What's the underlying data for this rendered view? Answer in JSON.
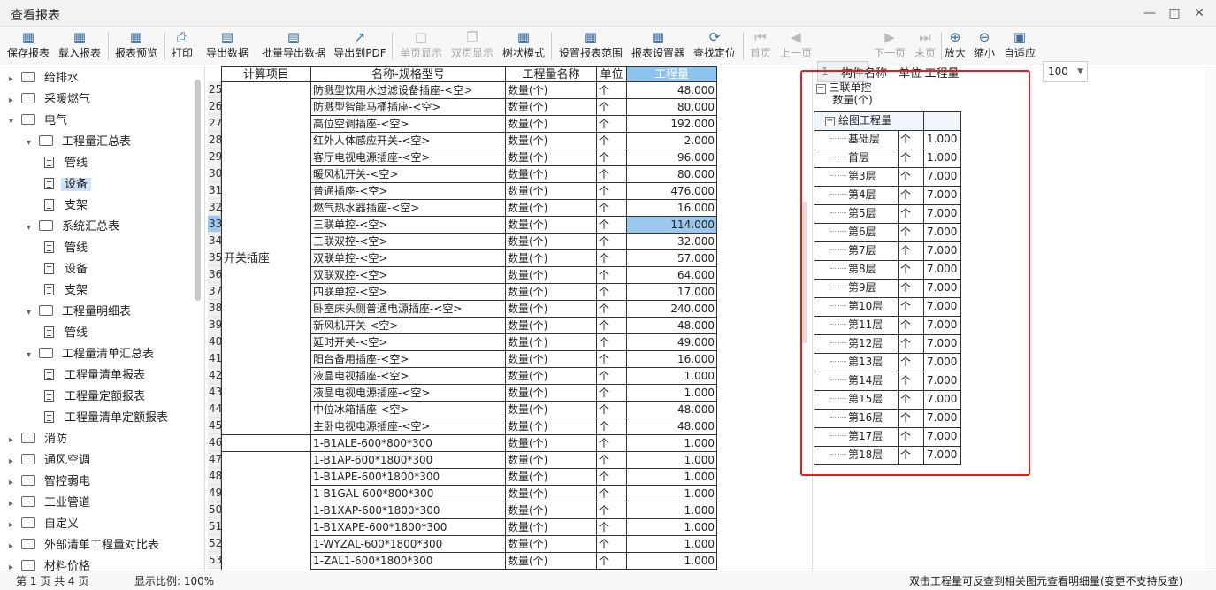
{
  "window": {
    "title": "查看报表"
  },
  "toolbar": {
    "save_report": "保存报表",
    "load_report": "载入报表",
    "preview_report": "报表预览",
    "print": "打印",
    "export_data": "导出数据",
    "batch_export": "批量导出数据",
    "export_pdf": "导出到PDF",
    "single_page": "单页显示",
    "two_page": "双页显示",
    "tree_mode": "树状模式",
    "set_range": "设置报表范围",
    "report_designer": "报表设置器",
    "find_locate": "查找定位",
    "first_page": "首页",
    "prev_page": "上一页",
    "page_value": "1",
    "next_page": "下一页",
    "last_page": "末页",
    "zoom_in": "放大",
    "zoom_out": "缩小",
    "fit": "自适应",
    "zoom_value": "100"
  },
  "tree": [
    {
      "label": "给排水",
      "level": 0,
      "type": "folder",
      "expanded": false
    },
    {
      "label": "采暖燃气",
      "level": 0,
      "type": "folder",
      "expanded": false
    },
    {
      "label": "电气",
      "level": 0,
      "type": "folder",
      "expanded": true
    },
    {
      "label": "工程量汇总表",
      "level": 1,
      "type": "folder",
      "expanded": true
    },
    {
      "label": "管线",
      "level": 2,
      "type": "doc"
    },
    {
      "label": "设备",
      "level": 2,
      "type": "doc",
      "selected": true
    },
    {
      "label": "支架",
      "level": 2,
      "type": "doc"
    },
    {
      "label": "系统汇总表",
      "level": 1,
      "type": "folder",
      "expanded": true
    },
    {
      "label": "管线",
      "level": 2,
      "type": "doc"
    },
    {
      "label": "设备",
      "level": 2,
      "type": "doc"
    },
    {
      "label": "支架",
      "level": 2,
      "type": "doc"
    },
    {
      "label": "工程量明细表",
      "level": 1,
      "type": "folder",
      "expanded": true
    },
    {
      "label": "管线",
      "level": 2,
      "type": "doc"
    },
    {
      "label": "工程量清单汇总表",
      "level": 1,
      "type": "folder",
      "expanded": true
    },
    {
      "label": "工程量清单报表",
      "level": 2,
      "type": "doc"
    },
    {
      "label": "工程量定额报表",
      "level": 2,
      "type": "doc"
    },
    {
      "label": "工程量清单定额报表",
      "level": 2,
      "type": "doc"
    },
    {
      "label": "消防",
      "level": 0,
      "type": "folder",
      "expanded": false
    },
    {
      "label": "通风空调",
      "level": 0,
      "type": "folder",
      "expanded": false
    },
    {
      "label": "智控弱电",
      "level": 0,
      "type": "folder",
      "expanded": false
    },
    {
      "label": "工业管道",
      "level": 0,
      "type": "folder",
      "expanded": false
    },
    {
      "label": "自定义",
      "level": 0,
      "type": "folder",
      "expanded": false
    },
    {
      "label": "外部清单工程量对比表",
      "level": 0,
      "type": "folder",
      "expanded": false
    },
    {
      "label": "材料价格",
      "level": 0,
      "type": "folder",
      "expanded": false
    }
  ],
  "report": {
    "headers": {
      "calc_item": "计算项目",
      "name_spec": "名称-规格型号",
      "qty_name": "工程量名称",
      "unit": "单位",
      "qty": "工程量"
    },
    "category": "开关插座",
    "rows": [
      {
        "no": "25",
        "name": "防溅型饮用水过滤设备插座-<空>",
        "qty_name": "数量(个)",
        "unit": "个",
        "qty": "48.000"
      },
      {
        "no": "26",
        "name": "防溅型智能马桶插座-<空>",
        "qty_name": "数量(个)",
        "unit": "个",
        "qty": "80.000"
      },
      {
        "no": "27",
        "name": "高位空调插座-<空>",
        "qty_name": "数量(个)",
        "unit": "个",
        "qty": "192.000"
      },
      {
        "no": "28",
        "name": "红外人体感应开关-<空>",
        "qty_name": "数量(个)",
        "unit": "个",
        "qty": "2.000"
      },
      {
        "no": "29",
        "name": "客厅电视电源插座-<空>",
        "qty_name": "数量(个)",
        "unit": "个",
        "qty": "96.000"
      },
      {
        "no": "30",
        "name": "暖风机开关-<空>",
        "qty_name": "数量(个)",
        "unit": "个",
        "qty": "80.000"
      },
      {
        "no": "31",
        "name": "普通插座-<空>",
        "qty_name": "数量(个)",
        "unit": "个",
        "qty": "476.000"
      },
      {
        "no": "32",
        "name": "燃气热水器插座-<空>",
        "qty_name": "数量(个)",
        "unit": "个",
        "qty": "16.000"
      },
      {
        "no": "33",
        "name": "三联单控-<空>",
        "qty_name": "数量(个)",
        "unit": "个",
        "qty": "114.000",
        "selected": true
      },
      {
        "no": "34",
        "name": "三联双控-<空>",
        "qty_name": "数量(个)",
        "unit": "个",
        "qty": "32.000"
      },
      {
        "no": "35",
        "name": "双联单控-<空>",
        "qty_name": "数量(个)",
        "unit": "个",
        "qty": "57.000"
      },
      {
        "no": "36",
        "name": "双联双控-<空>",
        "qty_name": "数量(个)",
        "unit": "个",
        "qty": "64.000"
      },
      {
        "no": "37",
        "name": "四联单控-<空>",
        "qty_name": "数量(个)",
        "unit": "个",
        "qty": "17.000"
      },
      {
        "no": "38",
        "name": "卧室床头侧普通电源插座-<空>",
        "qty_name": "数量(个)",
        "unit": "个",
        "qty": "240.000"
      },
      {
        "no": "39",
        "name": "新风机开关-<空>",
        "qty_name": "数量(个)",
        "unit": "个",
        "qty": "48.000"
      },
      {
        "no": "40",
        "name": "延时开关-<空>",
        "qty_name": "数量(个)",
        "unit": "个",
        "qty": "49.000"
      },
      {
        "no": "41",
        "name": "阳台备用插座-<空>",
        "qty_name": "数量(个)",
        "unit": "个",
        "qty": "16.000"
      },
      {
        "no": "42",
        "name": "液晶电视插座-<空>",
        "qty_name": "数量(个)",
        "unit": "个",
        "qty": "1.000"
      },
      {
        "no": "43",
        "name": "液晶电视电源插座-<空>",
        "qty_name": "数量(个)",
        "unit": "个",
        "qty": "1.000"
      },
      {
        "no": "44",
        "name": "中位冰箱插座-<空>",
        "qty_name": "数量(个)",
        "unit": "个",
        "qty": "48.000"
      },
      {
        "no": "45",
        "name": "主卧电视电源插座-<空>",
        "qty_name": "数量(个)",
        "unit": "个",
        "qty": "48.000"
      },
      {
        "no": "46",
        "name": "1-B1ALE-600*800*300",
        "qty_name": "数量(个)",
        "unit": "个",
        "qty": "1.000"
      },
      {
        "no": "47",
        "name": "1-B1AP-600*1800*300",
        "qty_name": "数量(个)",
        "unit": "个",
        "qty": "1.000"
      },
      {
        "no": "48",
        "name": "1-B1APE-600*1800*300",
        "qty_name": "数量(个)",
        "unit": "个",
        "qty": "1.000"
      },
      {
        "no": "49",
        "name": "1-B1GAL-600*800*300",
        "qty_name": "数量(个)",
        "unit": "个",
        "qty": "1.000"
      },
      {
        "no": "50",
        "name": "1-B1XAP-600*1800*300",
        "qty_name": "数量(个)",
        "unit": "个",
        "qty": "1.000"
      },
      {
        "no": "51",
        "name": "1-B1XAPE-600*1800*300",
        "qty_name": "数量(个)",
        "unit": "个",
        "qty": "1.000"
      },
      {
        "no": "52",
        "name": "1-WYZAL-600*1800*300",
        "qty_name": "数量(个)",
        "unit": "个",
        "qty": "1.000"
      },
      {
        "no": "53",
        "name": "1-ZAL1-600*1800*300",
        "qty_name": "数量(个)",
        "unit": "个",
        "qty": "1.000"
      }
    ]
  },
  "detail": {
    "headers": {
      "component": "构件名称",
      "unit": "单位",
      "qty": "工程量"
    },
    "component": "三联单控",
    "component_sub": "数量(个)",
    "group": "绘图工程量",
    "floors": [
      {
        "name": "基础层",
        "unit": "个",
        "qty": "1.000"
      },
      {
        "name": "首层",
        "unit": "个",
        "qty": "1.000"
      },
      {
        "name": "第3层",
        "unit": "个",
        "qty": "7.000"
      },
      {
        "name": "第4层",
        "unit": "个",
        "qty": "7.000"
      },
      {
        "name": "第5层",
        "unit": "个",
        "qty": "7.000"
      },
      {
        "name": "第6层",
        "unit": "个",
        "qty": "7.000"
      },
      {
        "name": "第7层",
        "unit": "个",
        "qty": "7.000"
      },
      {
        "name": "第8层",
        "unit": "个",
        "qty": "7.000"
      },
      {
        "name": "第9层",
        "unit": "个",
        "qty": "7.000"
      },
      {
        "name": "第10层",
        "unit": "个",
        "qty": "7.000"
      },
      {
        "name": "第11层",
        "unit": "个",
        "qty": "7.000"
      },
      {
        "name": "第12层",
        "unit": "个",
        "qty": "7.000"
      },
      {
        "name": "第13层",
        "unit": "个",
        "qty": "7.000"
      },
      {
        "name": "第14层",
        "unit": "个",
        "qty": "7.000"
      },
      {
        "name": "第15层",
        "unit": "个",
        "qty": "7.000"
      },
      {
        "name": "第16层",
        "unit": "个",
        "qty": "7.000"
      },
      {
        "name": "第17层",
        "unit": "个",
        "qty": "7.000"
      },
      {
        "name": "第18层",
        "unit": "个",
        "qty": "7.000"
      }
    ]
  },
  "status": {
    "page_text": "第 1 页 共 4 页",
    "ratio_text": "显示比例: 100%",
    "hint": "双击工程量可反查到相关图元查看明细量(变更不支持反查)"
  },
  "colors": {
    "header_highlight": "#8ec3f0",
    "selection": "#9cc7ef",
    "highlight_box": "#e02020"
  }
}
